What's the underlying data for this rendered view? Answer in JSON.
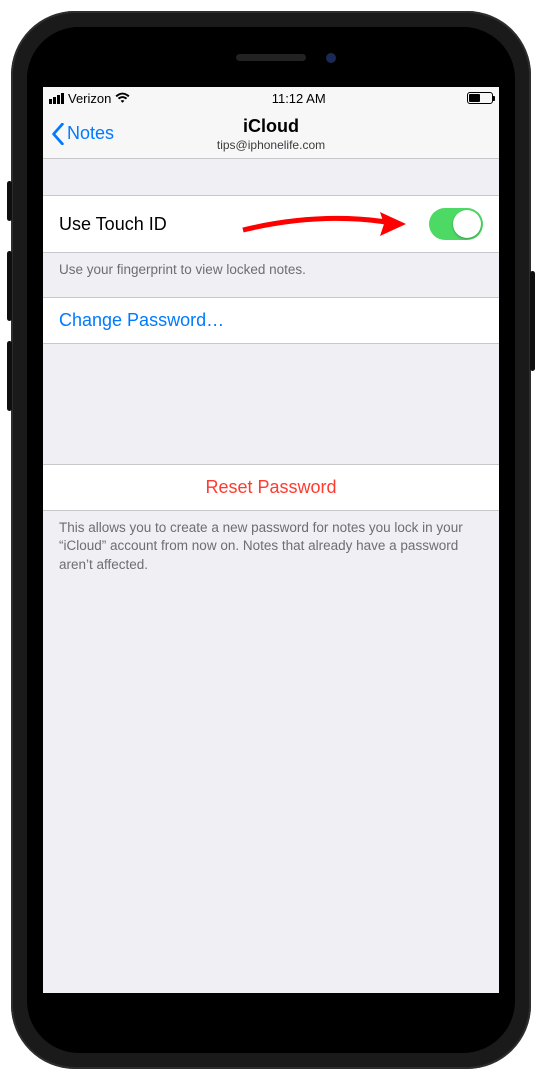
{
  "status": {
    "carrier": "Verizon",
    "time": "11:12 AM",
    "battery_percent": 50
  },
  "nav": {
    "back_label": "Notes",
    "title": "iCloud",
    "subtitle": "tips@iphonelife.com"
  },
  "touch_id": {
    "label": "Use Touch ID",
    "enabled": true,
    "footer": "Use your fingerprint to view locked notes."
  },
  "change_password": {
    "label": "Change Password…"
  },
  "reset_password": {
    "label": "Reset Password",
    "footer": "This allows you to create a new password for notes you lock in your “iCloud” account from now on. Notes that already have a password aren’t affected."
  },
  "colors": {
    "tint": "#007aff",
    "destructive": "#ff3b30",
    "toggle_on": "#4cd964"
  }
}
